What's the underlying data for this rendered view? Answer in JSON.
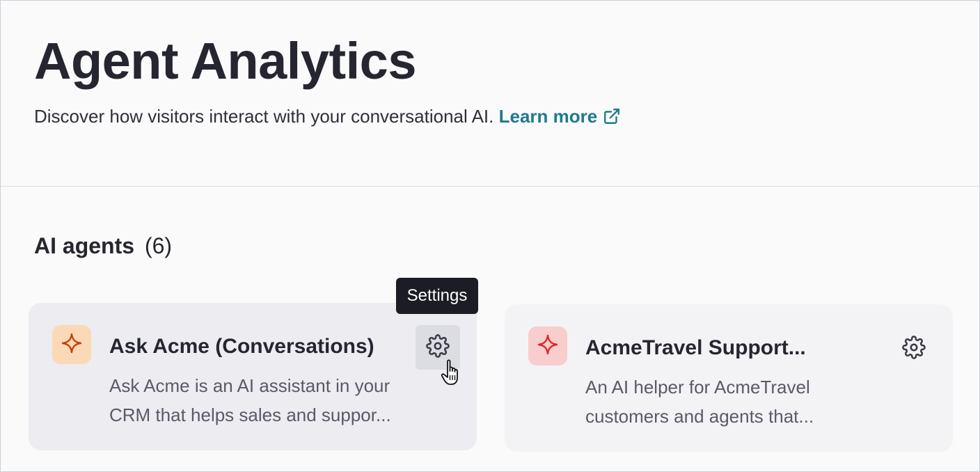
{
  "header": {
    "title": "Agent Analytics",
    "subtitle": "Discover how visitors interact with your conversational AI.",
    "learn_more_label": "Learn more"
  },
  "section": {
    "title": "AI agents",
    "count": "(6)"
  },
  "agents": [
    {
      "name": "Ask Acme (Conversations)",
      "description_line1": "Ask Acme is an AI assistant in your",
      "description_line2": "CRM that helps sales and suppor...",
      "icon": "sparkle-icon",
      "icon_bg": "#fcd9b6",
      "icon_color": "#c2410c"
    },
    {
      "name": "AcmeTravel Support...",
      "description_line1": "An AI helper for AcmeTravel",
      "description_line2": "customers and agents that...",
      "icon": "sparkle-icon",
      "icon_bg": "#f8cdcd",
      "icon_color": "#dc2626"
    }
  ],
  "tooltip": {
    "text": "Settings"
  },
  "colors": {
    "link": "#1f7a8c",
    "tooltip_bg": "#1c1c24",
    "text": "#262630"
  }
}
